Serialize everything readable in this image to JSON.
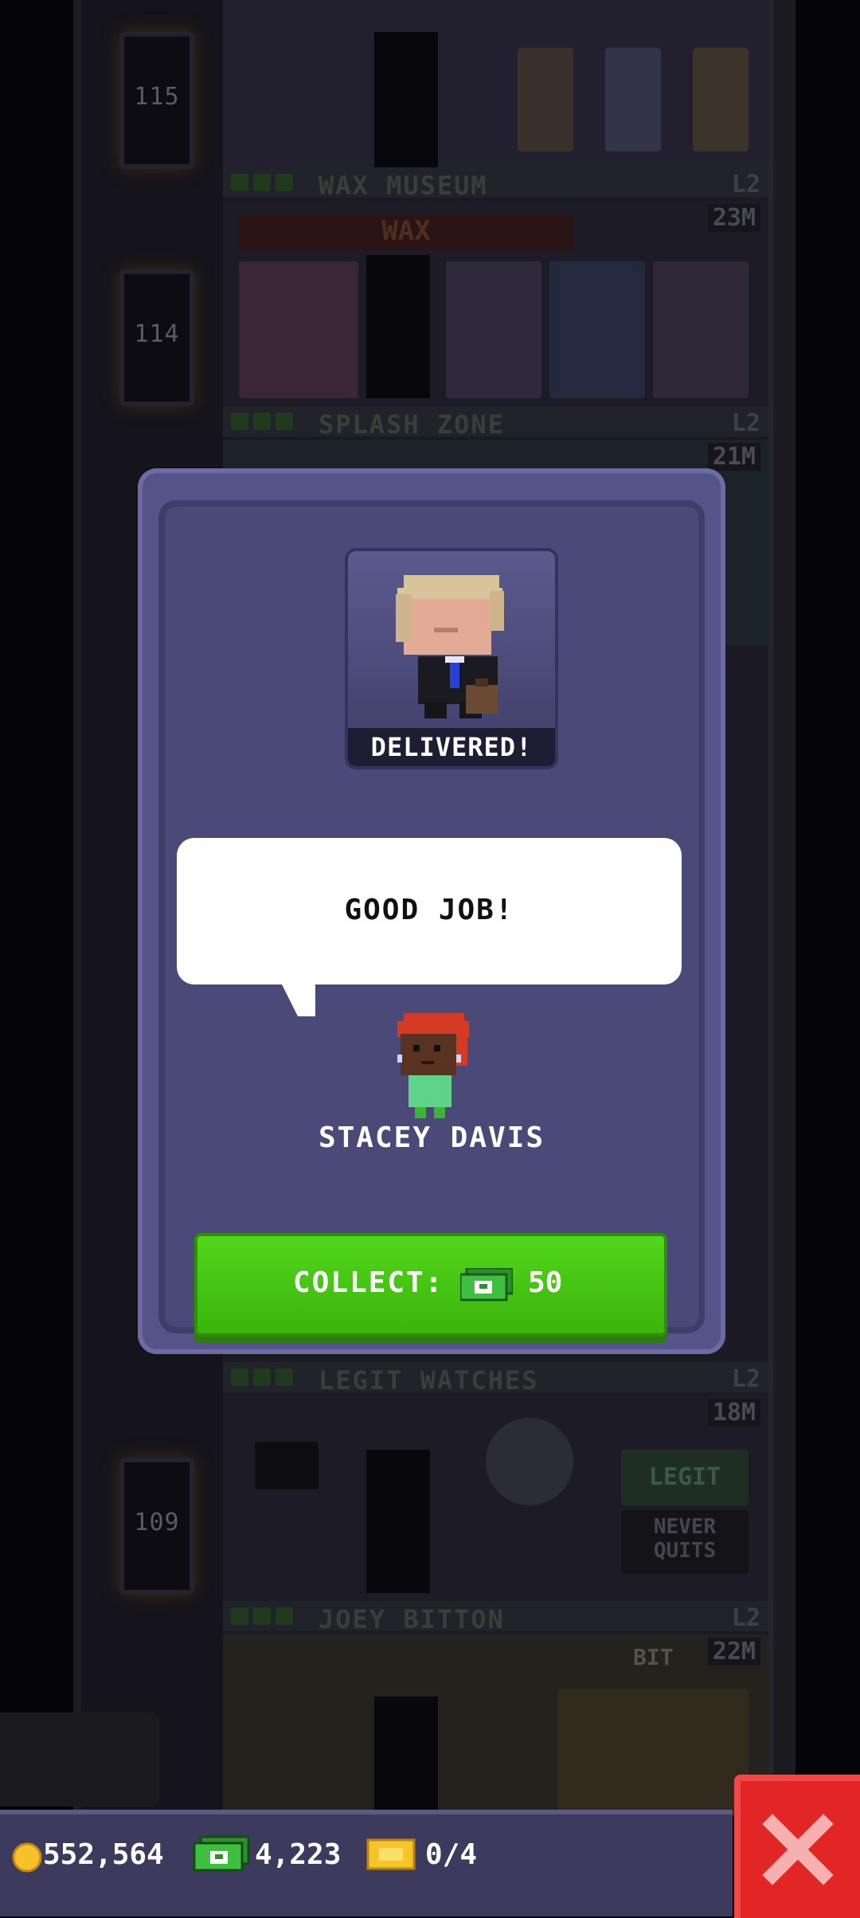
{
  "colors": {
    "modal": "#55548a",
    "collect_button": "#4cc914",
    "close_button": "#e22525",
    "coins": "#f7c12a",
    "bux": "#2fae2f"
  },
  "tower": {
    "elevator_floors": [
      "115",
      "114",
      "109"
    ],
    "floors": [
      {
        "name": "WAX MUSEUM",
        "level": "L2",
        "value": "23M"
      },
      {
        "name": "SPLASH ZONE",
        "level": "L2",
        "value": "21M"
      },
      {
        "name": "LEGIT WATCHES",
        "level": "L2",
        "value": "18M"
      },
      {
        "name": "JOEY BITTON",
        "level": "L2",
        "value": "22M"
      }
    ],
    "signs": {
      "wax": "WAX",
      "legit": "LEGIT",
      "never_quits": "NEVER QUITS",
      "bit": "BIT"
    }
  },
  "modal": {
    "status": "DELIVERED!",
    "speech": "GOOD JOB!",
    "npc_name": "STACEY DAVIS",
    "collect_label": "COLLECT:",
    "collect_amount": "50",
    "collect_icon": "bux-icon"
  },
  "status_bar": {
    "coins": "552,564",
    "bux": "4,223",
    "tickets": "0/4",
    "close_icon": "close-icon"
  }
}
